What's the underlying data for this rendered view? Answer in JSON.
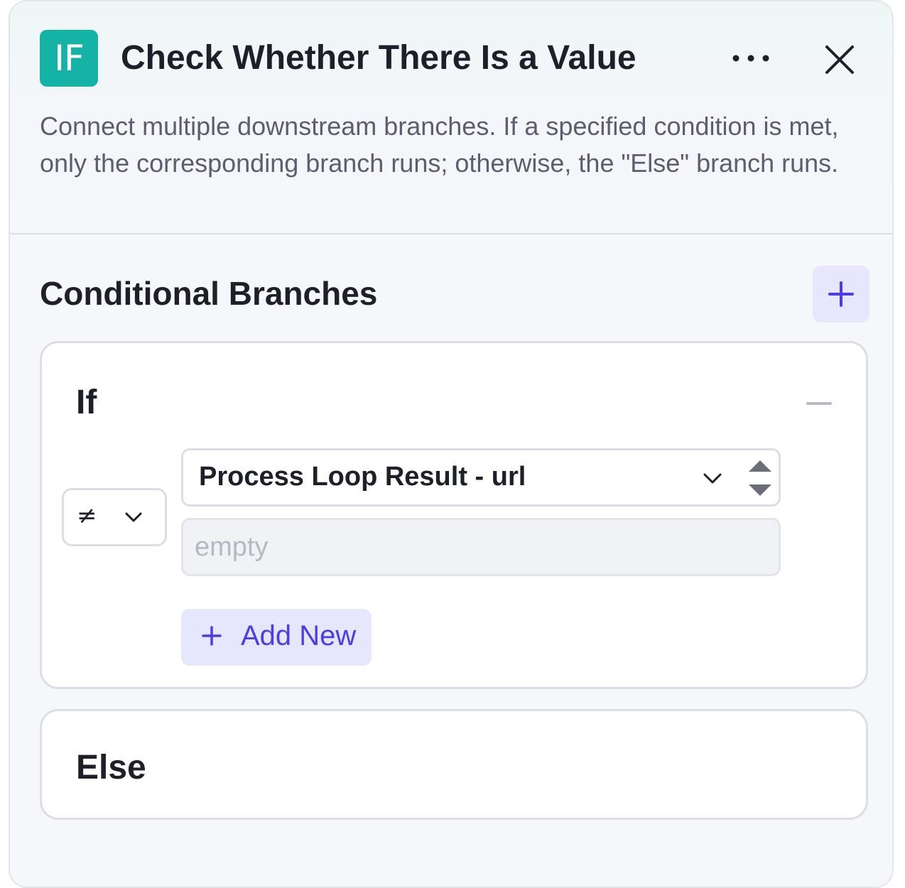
{
  "header": {
    "badge": "IF",
    "title": "Check Whether There Is a Value",
    "description": "Connect multiple downstream branches. If a specified condition is met, only the corresponding branch runs; otherwise, the \"Else\" branch runs."
  },
  "section": {
    "title": "Conditional Branches"
  },
  "if_branch": {
    "label": "If",
    "condition": {
      "operator": "≠",
      "variable": "Process Loop Result - url",
      "value_placeholder": "empty"
    },
    "add_new_label": "Add New"
  },
  "else_branch": {
    "label": "Else"
  },
  "icons": {
    "more": "more-horizontal-icon",
    "close": "close-icon",
    "add": "plus-icon",
    "remove": "minus-icon",
    "chevron": "chevron-down-icon",
    "stepper": "stepper-arrows-icon"
  },
  "colors": {
    "badge": "#14b3a6",
    "accent": "#4b3de8",
    "accent_bg": "#e6e6fc"
  }
}
